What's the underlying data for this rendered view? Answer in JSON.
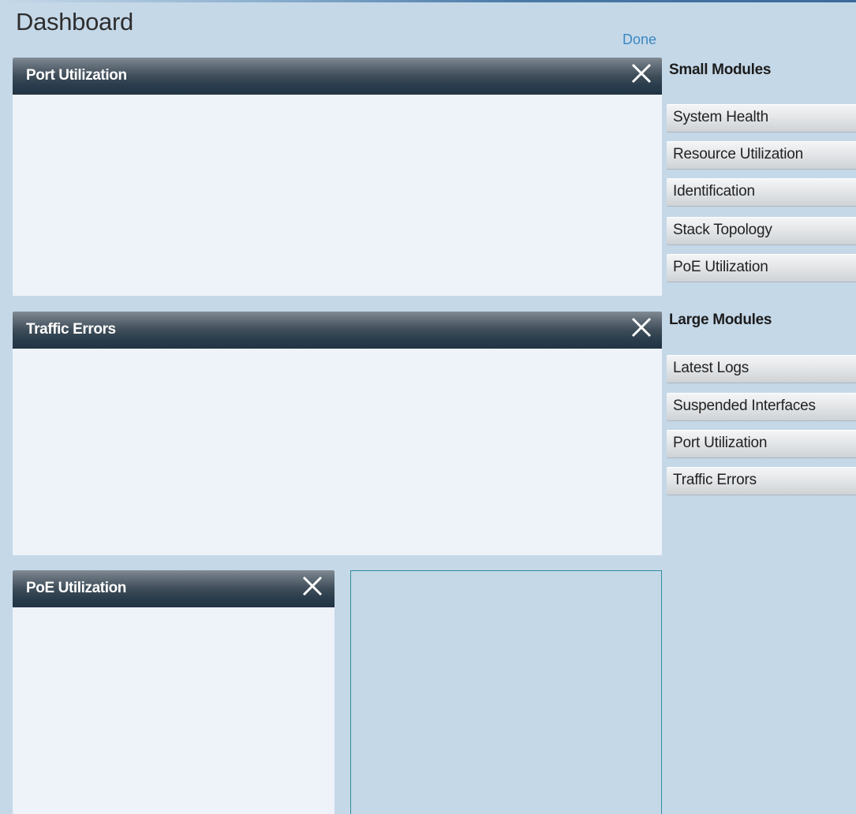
{
  "page": {
    "title": "Dashboard",
    "done_label": "Done"
  },
  "modules": {
    "port_utilization": {
      "title": "Port Utilization"
    },
    "traffic_errors": {
      "title": "Traffic Errors"
    },
    "poe_utilization": {
      "title": "PoE Utilization"
    }
  },
  "sidebar": {
    "small_heading": "Small Modules",
    "small_items": [
      "System Health",
      "Resource Utilization",
      "Identification",
      "Stack Topology",
      "PoE Utilization"
    ],
    "large_heading": "Large Modules",
    "large_items": [
      "Latest Logs",
      "Suspended Interfaces",
      "Port Utilization",
      "Traffic Errors"
    ]
  },
  "colors": {
    "background": "#c5d8e8",
    "module_body": "#eef2f9",
    "header_dark": "#213444",
    "link": "#3b87c1",
    "drop_zone_border": "#2f8c9a"
  },
  "icons": {
    "close": "close-icon"
  }
}
